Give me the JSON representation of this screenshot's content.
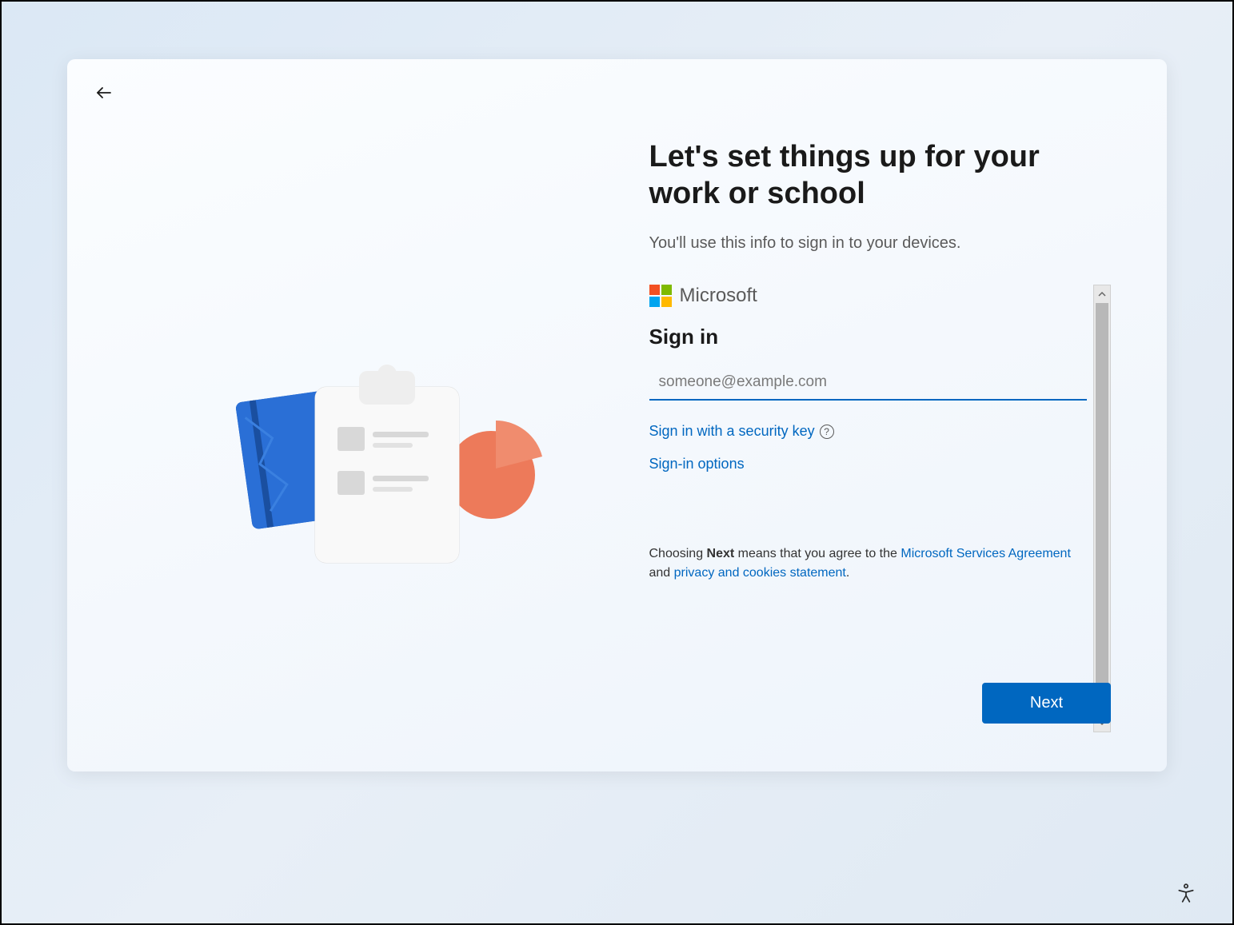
{
  "page": {
    "title": "Let's set things up for your work or school",
    "subtitle": "You'll use this info to sign in to your devices."
  },
  "brand": {
    "name": "Microsoft"
  },
  "signin": {
    "heading": "Sign in",
    "email_placeholder": "someone@example.com",
    "email_value": "",
    "security_key_link": "Sign in with a security key",
    "options_link": "Sign-in options"
  },
  "agreement": {
    "prefix": "Choosing ",
    "bold_word": "Next",
    "middle": " means that you agree to the ",
    "link1": "Microsoft Services Agreement",
    "and": " and ",
    "link2": "privacy and cookies statement",
    "suffix": "."
  },
  "buttons": {
    "next": "Next"
  }
}
